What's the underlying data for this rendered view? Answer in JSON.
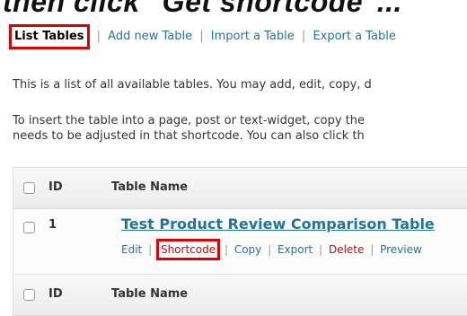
{
  "caption": "then click \"Get shortcode\"...",
  "subnav": {
    "current": "List Tables",
    "links": [
      "Add new Table",
      "Import a Table",
      "Export a Table"
    ],
    "separator": "|"
  },
  "paragraphs": {
    "p1": "This is a list of all available tables. You may add, edit, copy, d",
    "p2_line1": "To insert the table into a page, post or text-widget, copy the",
    "p2_line2": "needs to be adjusted in that shortcode. You can also click th"
  },
  "table": {
    "header": {
      "id": "ID",
      "name": "Table Name"
    },
    "footer": {
      "id": "ID",
      "name": "Table Name"
    },
    "rows": [
      {
        "id": "1",
        "name": "Test Product Review Comparison Table",
        "actions": {
          "edit": "Edit",
          "shortcode": "Shortcode",
          "copy": "Copy",
          "export": "Export",
          "delete": "Delete",
          "preview": "Preview"
        }
      }
    ]
  },
  "colors": {
    "link": "#21759b",
    "delete": "#bc0b0b",
    "highlight_box": "#e00000"
  }
}
